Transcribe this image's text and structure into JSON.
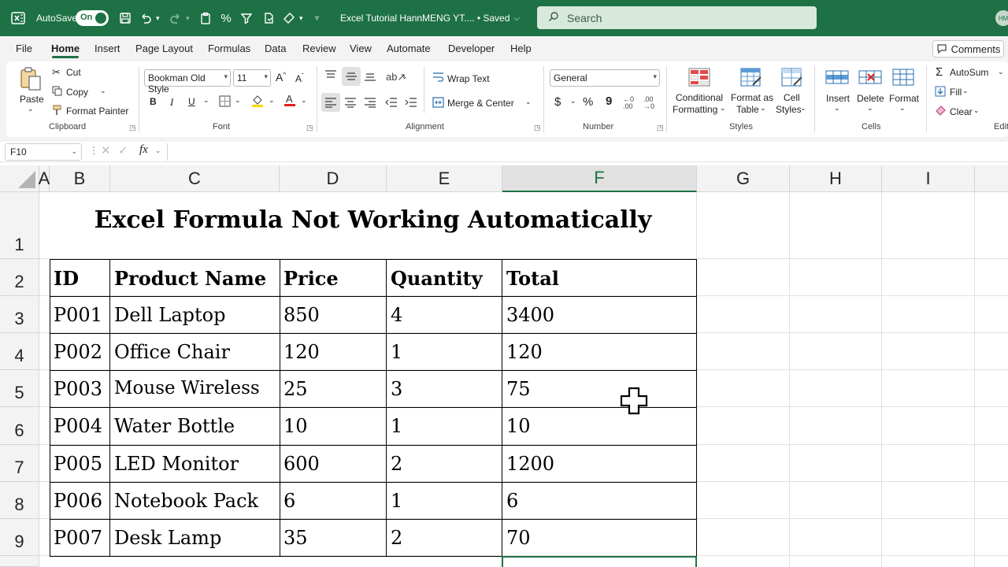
{
  "titlebar": {
    "autosave_label": "AutoSave",
    "autosave_state": "On",
    "doc_title": "Excel Tutorial HannMENG YT.... • Saved",
    "search_placeholder": "Search",
    "avatar_initials": "HM"
  },
  "menu": {
    "tabs": [
      "File",
      "Home",
      "Insert",
      "Page Layout",
      "Formulas",
      "Data",
      "Review",
      "View",
      "Automate",
      "Developer",
      "Help"
    ],
    "active_tab": "Home",
    "comments_label": "Comments"
  },
  "ribbon": {
    "clipboard": {
      "paste": "Paste",
      "cut": "Cut",
      "copy": "Copy",
      "format_painter": "Format Painter",
      "label": "Clipboard"
    },
    "font": {
      "font_name": "Bookman Old Style",
      "font_size": "11",
      "bold": "B",
      "italic": "I",
      "underline": "U",
      "label": "Font"
    },
    "alignment": {
      "wrap_text": "Wrap Text",
      "merge_center": "Merge & Center",
      "label": "Alignment"
    },
    "number": {
      "format": "General",
      "currency": "$",
      "percent": "%",
      "comma": "9",
      "label": "Number"
    },
    "styles": {
      "conditional_formatting": [
        "Conditional",
        "Formatting"
      ],
      "format_as_table": [
        "Format as",
        "Table"
      ],
      "cell_styles": [
        "Cell",
        "Styles"
      ],
      "label": "Styles"
    },
    "cells": {
      "insert": "Insert",
      "delete": "Delete",
      "format": "Format",
      "label": "Cells"
    },
    "editing": {
      "autosum": "AutoSum",
      "fill": "Fill",
      "clear": "Clear",
      "label": "Edit"
    }
  },
  "formula_bar": {
    "name_box": "F10",
    "fx": "fx",
    "content": ""
  },
  "sheet": {
    "columns": [
      "A",
      "B",
      "C",
      "D",
      "E",
      "F",
      "G",
      "H",
      "I"
    ],
    "selected_column": "F",
    "rows": [
      "1",
      "2",
      "3",
      "4",
      "5",
      "6",
      "7",
      "8",
      "9"
    ],
    "title": "Excel Formula Not Working Automatically",
    "table_headers": [
      "ID",
      "Product Name",
      "Price",
      "Quantity",
      "Total"
    ],
    "table_rows": [
      [
        "P001",
        "Dell Laptop",
        "850",
        "4",
        "3400"
      ],
      [
        "P002",
        "Office Chair",
        "120",
        "1",
        "120"
      ],
      [
        "P003",
        "Mouse Wireless",
        "25",
        "3",
        "75"
      ],
      [
        "P004",
        "Water Bottle",
        "10",
        "1",
        "10"
      ],
      [
        "P005",
        "LED Monitor",
        "600",
        "2",
        "1200"
      ],
      [
        "P006",
        "Notebook Pack",
        "6",
        "1",
        "6"
      ],
      [
        "P007",
        "Desk Lamp",
        "35",
        "2",
        "70"
      ]
    ]
  },
  "colors": {
    "excel_green": "#1e7145",
    "ribbon_bg": "#f3f3f3"
  }
}
